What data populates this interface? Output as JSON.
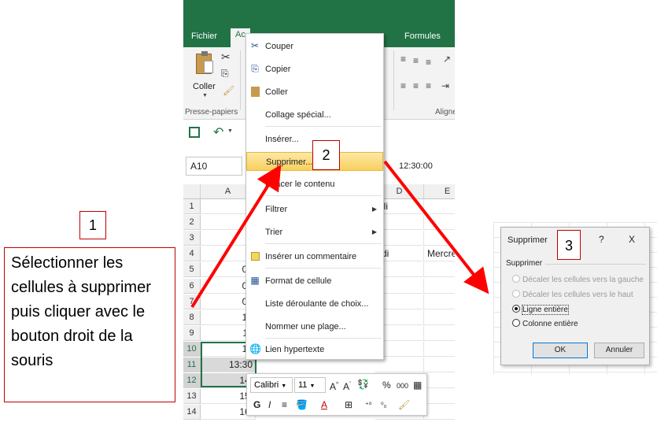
{
  "ribbon": {
    "tabs": [
      "Fichier",
      "Ac",
      "Formules"
    ],
    "paste_label": "Coller",
    "group_clipboard": "Presse-papiers",
    "group_align": "Aligne"
  },
  "formula_bar": {
    "name_box": "A10",
    "value": "12:30:00"
  },
  "grid": {
    "columns": [
      "A",
      "D",
      "E"
    ],
    "rows": [
      {
        "n": "1",
        "a": "",
        "d": "uli",
        "e": ""
      },
      {
        "n": "2",
        "a": "",
        "d": "",
        "e": ""
      },
      {
        "n": "3",
        "a": "",
        "d": "",
        "e": ""
      },
      {
        "n": "4",
        "a": "",
        "d": "rdi",
        "e": "Mercre"
      },
      {
        "n": "5",
        "a": "07",
        "d": "",
        "e": ""
      },
      {
        "n": "6",
        "a": "08",
        "d": "",
        "e": ""
      },
      {
        "n": "7",
        "a": "09",
        "d": "",
        "e": ""
      },
      {
        "n": "8",
        "a": "10",
        "d": "",
        "e": ""
      },
      {
        "n": "9",
        "a": "11",
        "d": "",
        "e": ""
      },
      {
        "n": "10",
        "a": "12",
        "d": "",
        "e": ""
      },
      {
        "n": "11",
        "a": "13:30",
        "d": "",
        "e": ""
      },
      {
        "n": "12",
        "a": "14:",
        "d": "",
        "e": ""
      },
      {
        "n": "13",
        "a": "15:",
        "d": "",
        "e": ""
      },
      {
        "n": "14",
        "a": "16:",
        "d": "",
        "e": ""
      }
    ]
  },
  "context_menu": {
    "items": [
      "Couper",
      "Copier",
      "Coller",
      "Collage spécial...",
      "Insérer...",
      "Supprimer...",
      "Effacer le contenu",
      "Filtrer",
      "Trier",
      "Insérer un commentaire",
      "Format de cellule",
      "Liste déroulante de choix...",
      "Nommer une plage...",
      "Lien hypertexte"
    ]
  },
  "mini_toolbar": {
    "font": "Calibri",
    "size": "11",
    "percent": "%",
    "thousands": "000"
  },
  "annotations": {
    "step1": "1",
    "step2": "2",
    "step3": "3",
    "instructions": "Sélectionner les cellules à supprimer puis cliquer avec le bouton droit de la souris"
  },
  "dialog": {
    "title": "Supprimer",
    "help": "?",
    "close": "X",
    "group": "Supprimer",
    "options": [
      "Décaler les cellules vers la gauche",
      "Décaler les cellules vers le haut",
      "Ligne entière",
      "Colonne entière"
    ],
    "ok": "OK",
    "cancel": "Annuler"
  },
  "colors": {
    "excel_green": "#217346",
    "annotation_red": "#c00000",
    "arrow_red": "#ff0000",
    "highlight": "#f9cf5e"
  }
}
